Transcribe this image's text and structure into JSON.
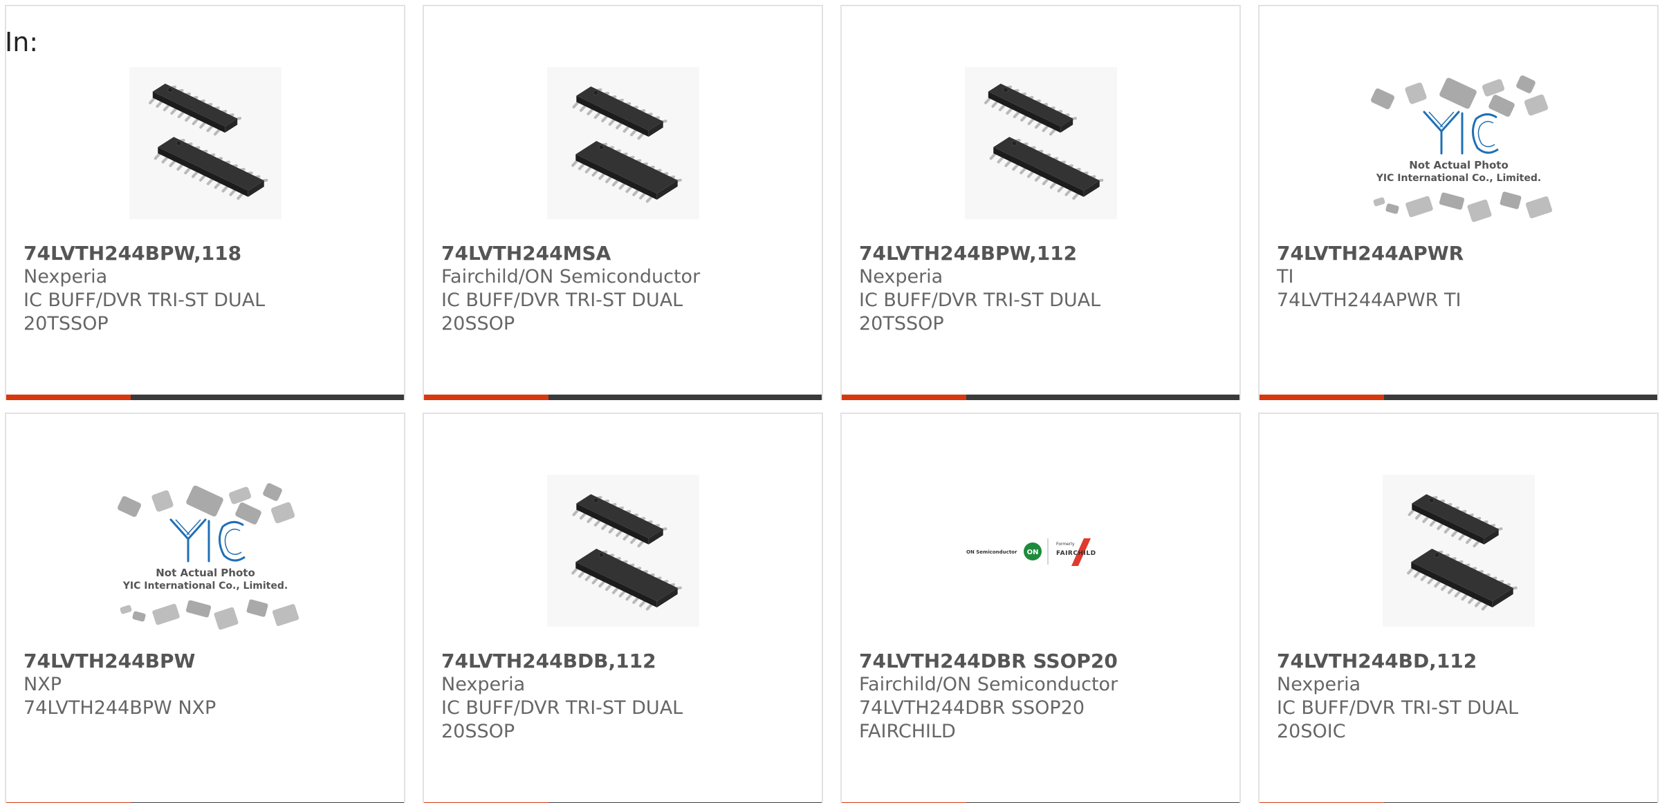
{
  "header": {
    "label": "In:"
  },
  "theme": {
    "accent": "#d7380d",
    "bar": "#3a3a3a",
    "border": "#e2e2e2"
  },
  "yic_placeholder": {
    "line1": "Not Actual Photo",
    "line2": "YIC International Co., Limited."
  },
  "onsemi_logo": {
    "left_text": "ON Semiconductor",
    "formerly": "Formerly",
    "right_text": "FAIRCHILD"
  },
  "products": [
    {
      "part": "74LVTH244BPW,118",
      "manufacturer": "Nexperia",
      "desc_lines": [
        "IC BUFF/DVR TRI-ST DUAL",
        "20TSSOP"
      ],
      "image": "tssop-chip-image"
    },
    {
      "part": "74LVTH244MSA",
      "manufacturer": "Fairchild/ON Semiconductor",
      "desc_lines": [
        "IC BUFF/DVR TRI-ST DUAL",
        "20SSOP"
      ],
      "image": "ssop-chip-image"
    },
    {
      "part": "74LVTH244BPW,112",
      "manufacturer": "Nexperia",
      "desc_lines": [
        "IC BUFF/DVR TRI-ST DUAL",
        "20TSSOP"
      ],
      "image": "tssop-chip-image"
    },
    {
      "part": "74LVTH244APWR",
      "manufacturer": "TI",
      "desc_lines": [
        "74LVTH244APWR TI"
      ],
      "image": "yic-placeholder-image"
    },
    {
      "part": "74LVTH244BPW",
      "manufacturer": "NXP",
      "desc_lines": [
        "74LVTH244BPW NXP"
      ],
      "image": "yic-placeholder-image"
    },
    {
      "part": "74LVTH244BDB,112",
      "manufacturer": "Nexperia",
      "desc_lines": [
        "IC BUFF/DVR TRI-ST DUAL",
        "20SSOP"
      ],
      "image": "ssop-chip-image"
    },
    {
      "part": "74LVTH244DBR SSOP20",
      "manufacturer": "Fairchild/ON Semiconductor",
      "desc_lines": [
        "74LVTH244DBR SSOP20",
        "FAIRCHILD"
      ],
      "image": "onsemi-fairchild-logo"
    },
    {
      "part": "74LVTH244BD,112",
      "manufacturer": "Nexperia",
      "desc_lines": [
        "IC BUFF/DVR TRI-ST DUAL",
        "20SOIC"
      ],
      "image": "soic-chip-image"
    }
  ]
}
